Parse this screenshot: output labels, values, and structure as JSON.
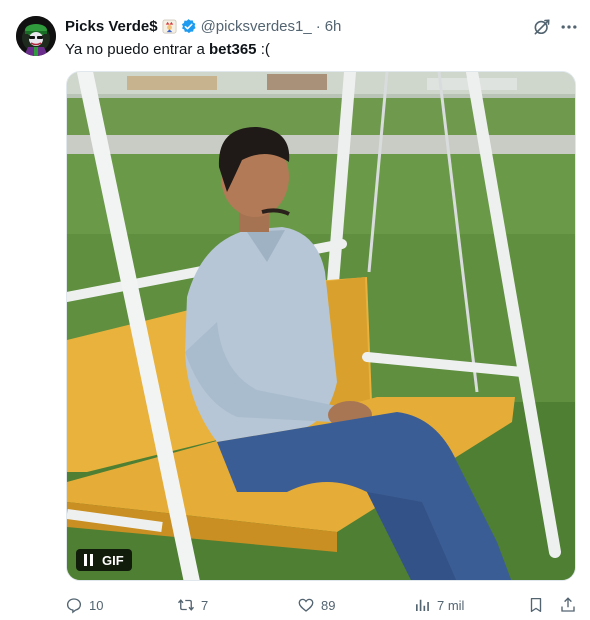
{
  "author": {
    "display_name": "Picks Verde$",
    "handle": "@picksverdes1_",
    "time": "6h"
  },
  "tweet": {
    "text_prefix": "Ya no puedo entrar a ",
    "text_bold": "bet365",
    "text_suffix": " :("
  },
  "media": {
    "gif_label": "GIF"
  },
  "actions": {
    "replies": "10",
    "retweets": "7",
    "likes": "89",
    "views": "7 mil"
  },
  "colors": {
    "verified": "#1d9bf0",
    "muted": "#536471"
  },
  "icons": [
    "joker-emoji-icon",
    "verified-badge-icon",
    "grok-icon",
    "more-icon",
    "pause-icon",
    "reply-icon",
    "retweet-icon",
    "like-icon",
    "views-icon",
    "bookmark-icon",
    "share-icon"
  ]
}
